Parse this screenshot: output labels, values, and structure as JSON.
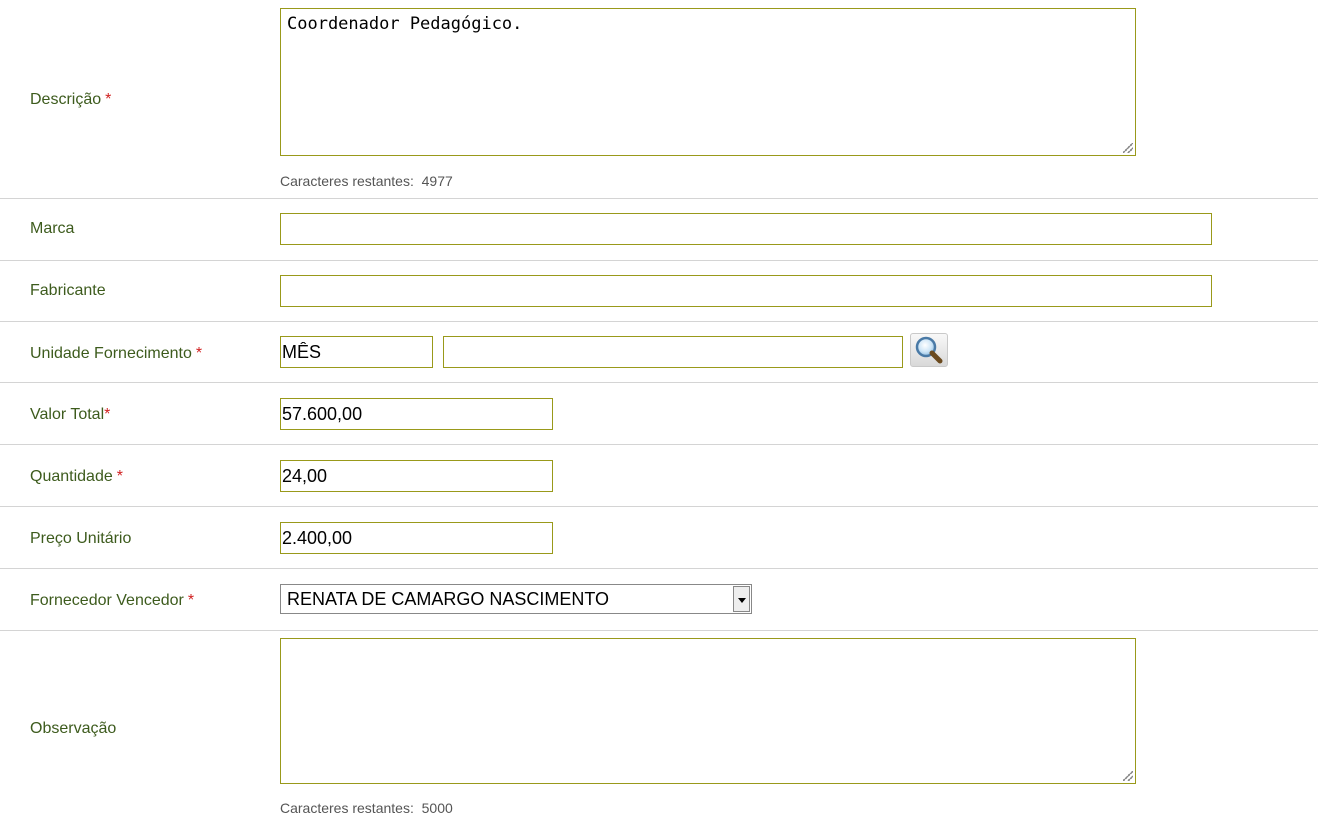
{
  "descricao": {
    "label": "Descrição",
    "required_mark": "*",
    "value": "Coordenador Pedagógico.",
    "remaining_label": "Caracteres restantes:",
    "remaining_count": "4977"
  },
  "marca": {
    "label": "Marca",
    "value": ""
  },
  "fabricante": {
    "label": "Fabricante",
    "value": ""
  },
  "unidade": {
    "label": "Unidade Fornecimento",
    "required_mark": "*",
    "code_value": "MÊS",
    "desc_value": "",
    "search_icon": "magnifier-icon"
  },
  "valor_total": {
    "label": "Valor Total",
    "required_mark": "*",
    "value": "57.600,00"
  },
  "quantidade": {
    "label": "Quantidade",
    "required_mark": "*",
    "value": "24,00"
  },
  "preco_unitario": {
    "label": "Preço Unitário",
    "value": "2.400,00"
  },
  "fornecedor": {
    "label": "Fornecedor Vencedor",
    "required_mark": "*",
    "selected": "RENATA DE CAMARGO NASCIMENTO"
  },
  "observacao": {
    "label": "Observação",
    "value": "",
    "remaining_label": "Caracteres restantes:",
    "remaining_count": "5000"
  },
  "colors": {
    "label_green": "#3d5b1d",
    "field_border": "#99991a",
    "required_red": "#d02020"
  }
}
